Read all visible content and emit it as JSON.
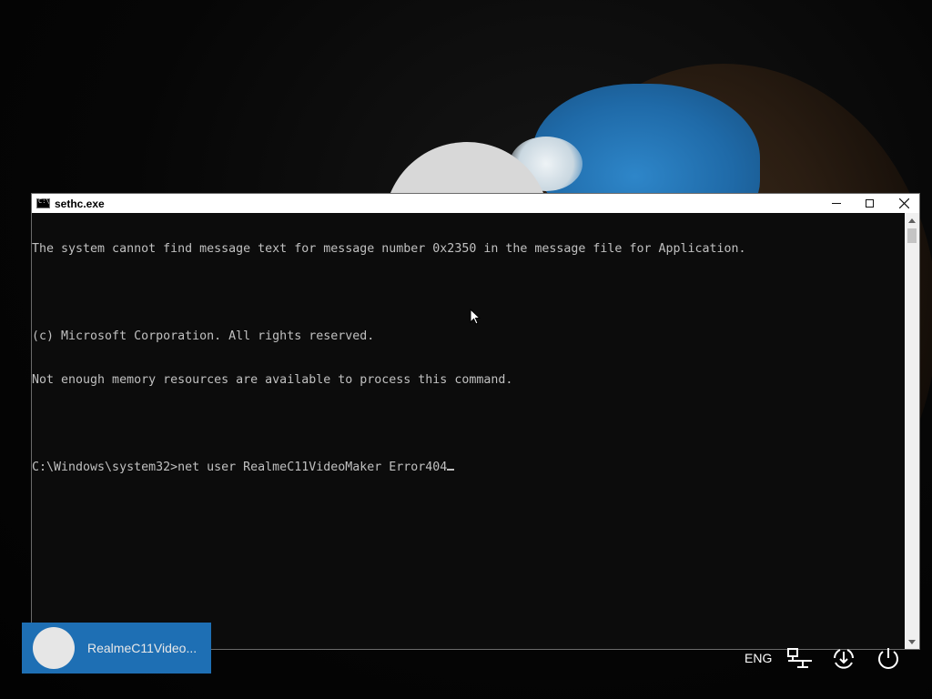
{
  "window": {
    "title": "sethc.exe",
    "icon": "console-icon",
    "controls": [
      "minimize-icon",
      "maximize-icon",
      "close-icon"
    ]
  },
  "console": {
    "lines": [
      "The system cannot find message text for message number 0x2350 in the message file for Application.",
      "",
      "(c) Microsoft Corporation. All rights reserved.",
      "Not enough memory resources are available to process this command.",
      "",
      "C:\\Windows\\system32>net user RealmeC11VideoMaker Error404"
    ]
  },
  "lock_screen": {
    "user_tile_name": "RealmeC11Video...",
    "language": "ENG",
    "tray_icons": [
      "network-icon",
      "ease-of-access-icon",
      "power-icon"
    ]
  },
  "colors": {
    "console_bg": "#0c0c0c",
    "console_text": "#c0c0c0",
    "user_tile_bg": "#1e6fb4"
  }
}
